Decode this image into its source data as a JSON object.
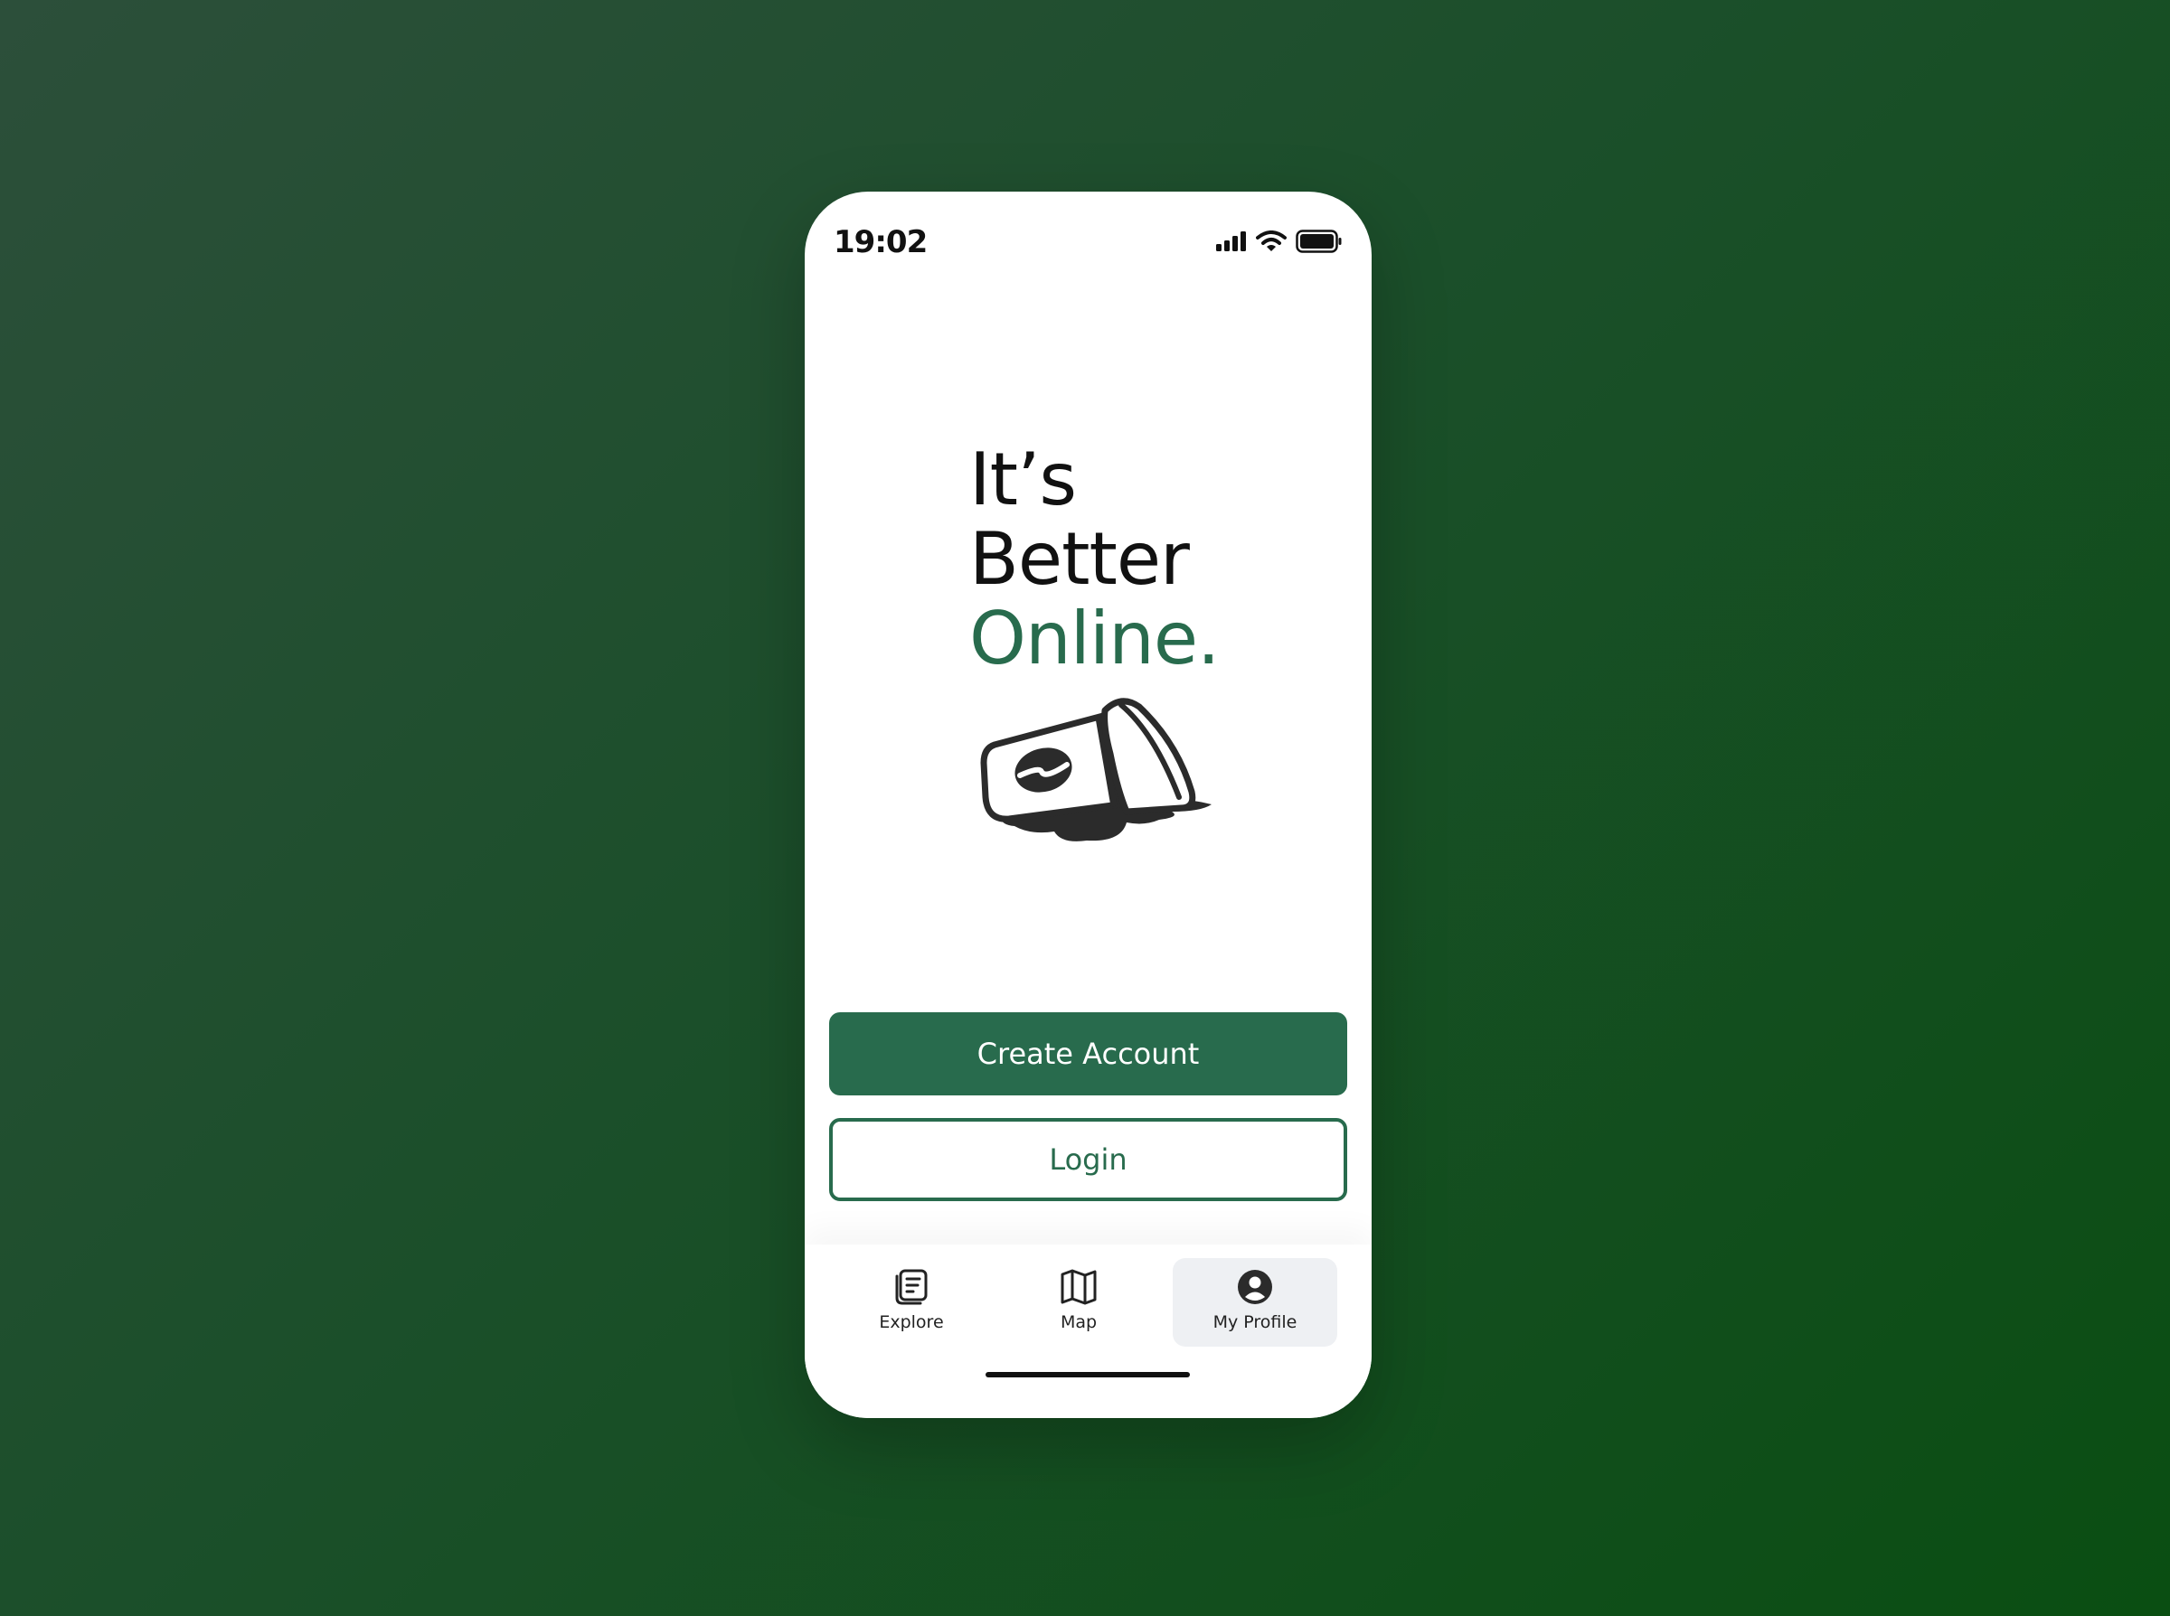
{
  "status_bar": {
    "time": "19:02",
    "icons": [
      "signal-icon",
      "wifi-icon",
      "battery-icon"
    ]
  },
  "hero": {
    "line1": "It’s",
    "line2": "Better",
    "line3": "Online.",
    "illustration": "spilled-coffee-cup-illustration"
  },
  "actions": {
    "create_account_label": "Create Account",
    "login_label": "Login"
  },
  "tabbar": {
    "items": [
      {
        "label": "Explore",
        "icon": "explore-icon",
        "active": false
      },
      {
        "label": "Map",
        "icon": "map-icon",
        "active": false
      },
      {
        "label": "My Profile",
        "icon": "profile-icon",
        "active": true
      }
    ]
  },
  "colors": {
    "accent": "#286b4d",
    "text": "#111111",
    "active_tab_bg": "#eef0f3",
    "background_gradient": [
      "#2c4f3a",
      "#0a4e12"
    ]
  }
}
